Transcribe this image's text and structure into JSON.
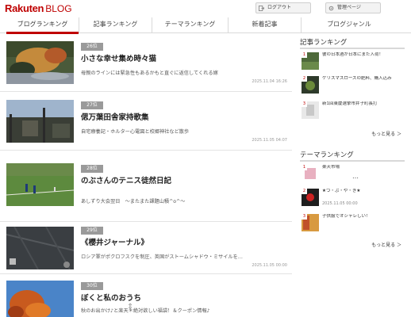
{
  "header": {
    "logo_rakuten": "Rakuten",
    "logo_blog": "BLOG",
    "logout_label": "ログアウト",
    "admin_label": "管理ページ"
  },
  "nav": {
    "tabs": [
      "ブログランキング",
      "記事ランキング",
      "テーマランキング",
      "新着記事",
      "ブログジャンル"
    ],
    "active_index": 0
  },
  "entries": [
    {
      "rank": "26位",
      "title": "小さな幸せ集め時々猫",
      "desc": "母親のラインには緊急性もあるかもと直ぐに返信してくれる嫁",
      "date": "2025.11.04 16:26"
    },
    {
      "rank": "27位",
      "title": "偲万葉田舎家持歌集",
      "desc": "自宅療養記・ホルター心電図と校郷神社など散歩",
      "date": "2025.11.05 04:07"
    },
    {
      "rank": "28位",
      "title": "のぶさんのテニス徒然日記",
      "desc": "あしずり大会翌日　～またまた課題山積^o^～",
      "date": ""
    },
    {
      "rank": "29位",
      "title": "《櫻井ジャーナル》",
      "desc": "ロシア軍がポクロフスクを制圧、英国がストームシャドウ・ミサイルを…",
      "date": "2025.11.05 00:00"
    },
    {
      "rank": "30位",
      "title": "ぼくと私のおうち",
      "desc": "秋のお出かけ♪と楽天＊絶対欲しい福袋！＆クーポン情報♪",
      "date": ""
    }
  ],
  "sidebar": {
    "article_ranking": {
      "title": "記事ランキング",
      "items": [
        {
          "num": "1",
          "text": "彼の日本酒が日本にまた入荷！"
        },
        {
          "num": "2",
          "text": "ケリスマスローズの肥料、購入込み"
        },
        {
          "num": "3",
          "text": "新1回東慶選挙市井子町長打"
        }
      ],
      "more": "もっと見る ＞"
    },
    "theme_ranking": {
      "title": "テーマランキング",
      "items": [
        {
          "num": "1",
          "text": "楽天市場",
          "sub": ""
        },
        {
          "num": "2",
          "text": "★つ・ぶ・や・き★",
          "sub": "2025.11.05 00:00"
        },
        {
          "num": "3",
          "text": "子供服でオシャレしい！",
          "sub": ""
        }
      ],
      "dots": "…",
      "more": "もっと見る ＞"
    }
  },
  "colors": {
    "brand": "#bf0000",
    "rank_badge": "#9a9a9a"
  }
}
